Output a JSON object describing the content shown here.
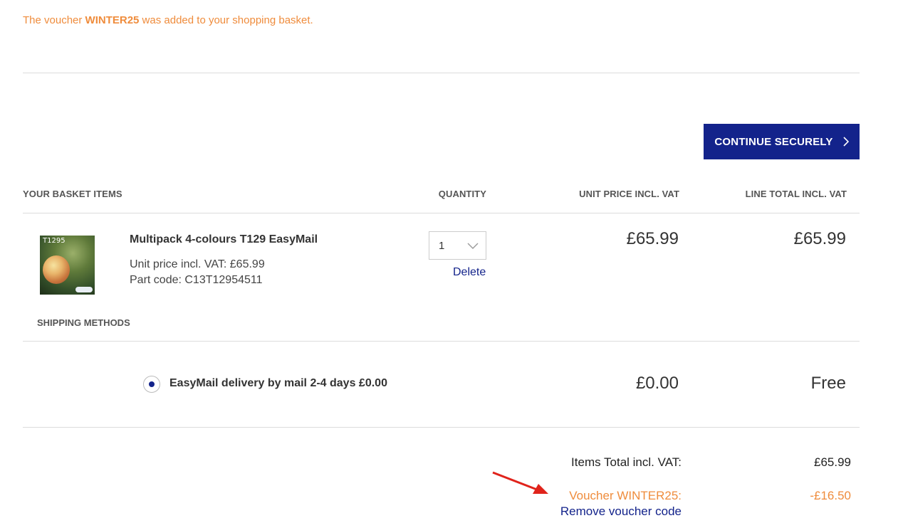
{
  "notice": {
    "prefix": "The voucher ",
    "code": "WINTER25",
    "suffix": " was added to your shopping basket."
  },
  "cta": {
    "label": "CONTINUE SECURELY",
    "icon": "chevron-right-icon"
  },
  "columns": {
    "items": "YOUR BASKET ITEMS",
    "quantity": "QUANTITY",
    "unit_price": "UNIT PRICE INCL. VAT",
    "line_total": "LINE TOTAL INCL. VAT"
  },
  "item": {
    "thumb_text": "T1295",
    "name": "Multipack 4-colours T129 EasyMail",
    "unit_price_line": "Unit price incl. VAT: £65.99",
    "part_code_line": "Part code: C13T12954511",
    "quantity": "1",
    "delete_label": "Delete",
    "unit_price": "£65.99",
    "line_total": "£65.99"
  },
  "shipping": {
    "heading": "SHIPPING METHODS",
    "option_label": "EasyMail delivery by mail 2-4 days £0.00",
    "price": "£0.00",
    "total": "Free"
  },
  "summary": {
    "items_total_label": "Items Total incl. VAT:",
    "items_total_value": "£65.99",
    "voucher_label": "Voucher WINTER25:",
    "voucher_value": "-£16.50",
    "remove_label": "Remove voucher code"
  },
  "colors": {
    "brand_blue": "#13238b",
    "notice_orange": "#ef8c3c",
    "arrow_red": "#e0231b"
  }
}
